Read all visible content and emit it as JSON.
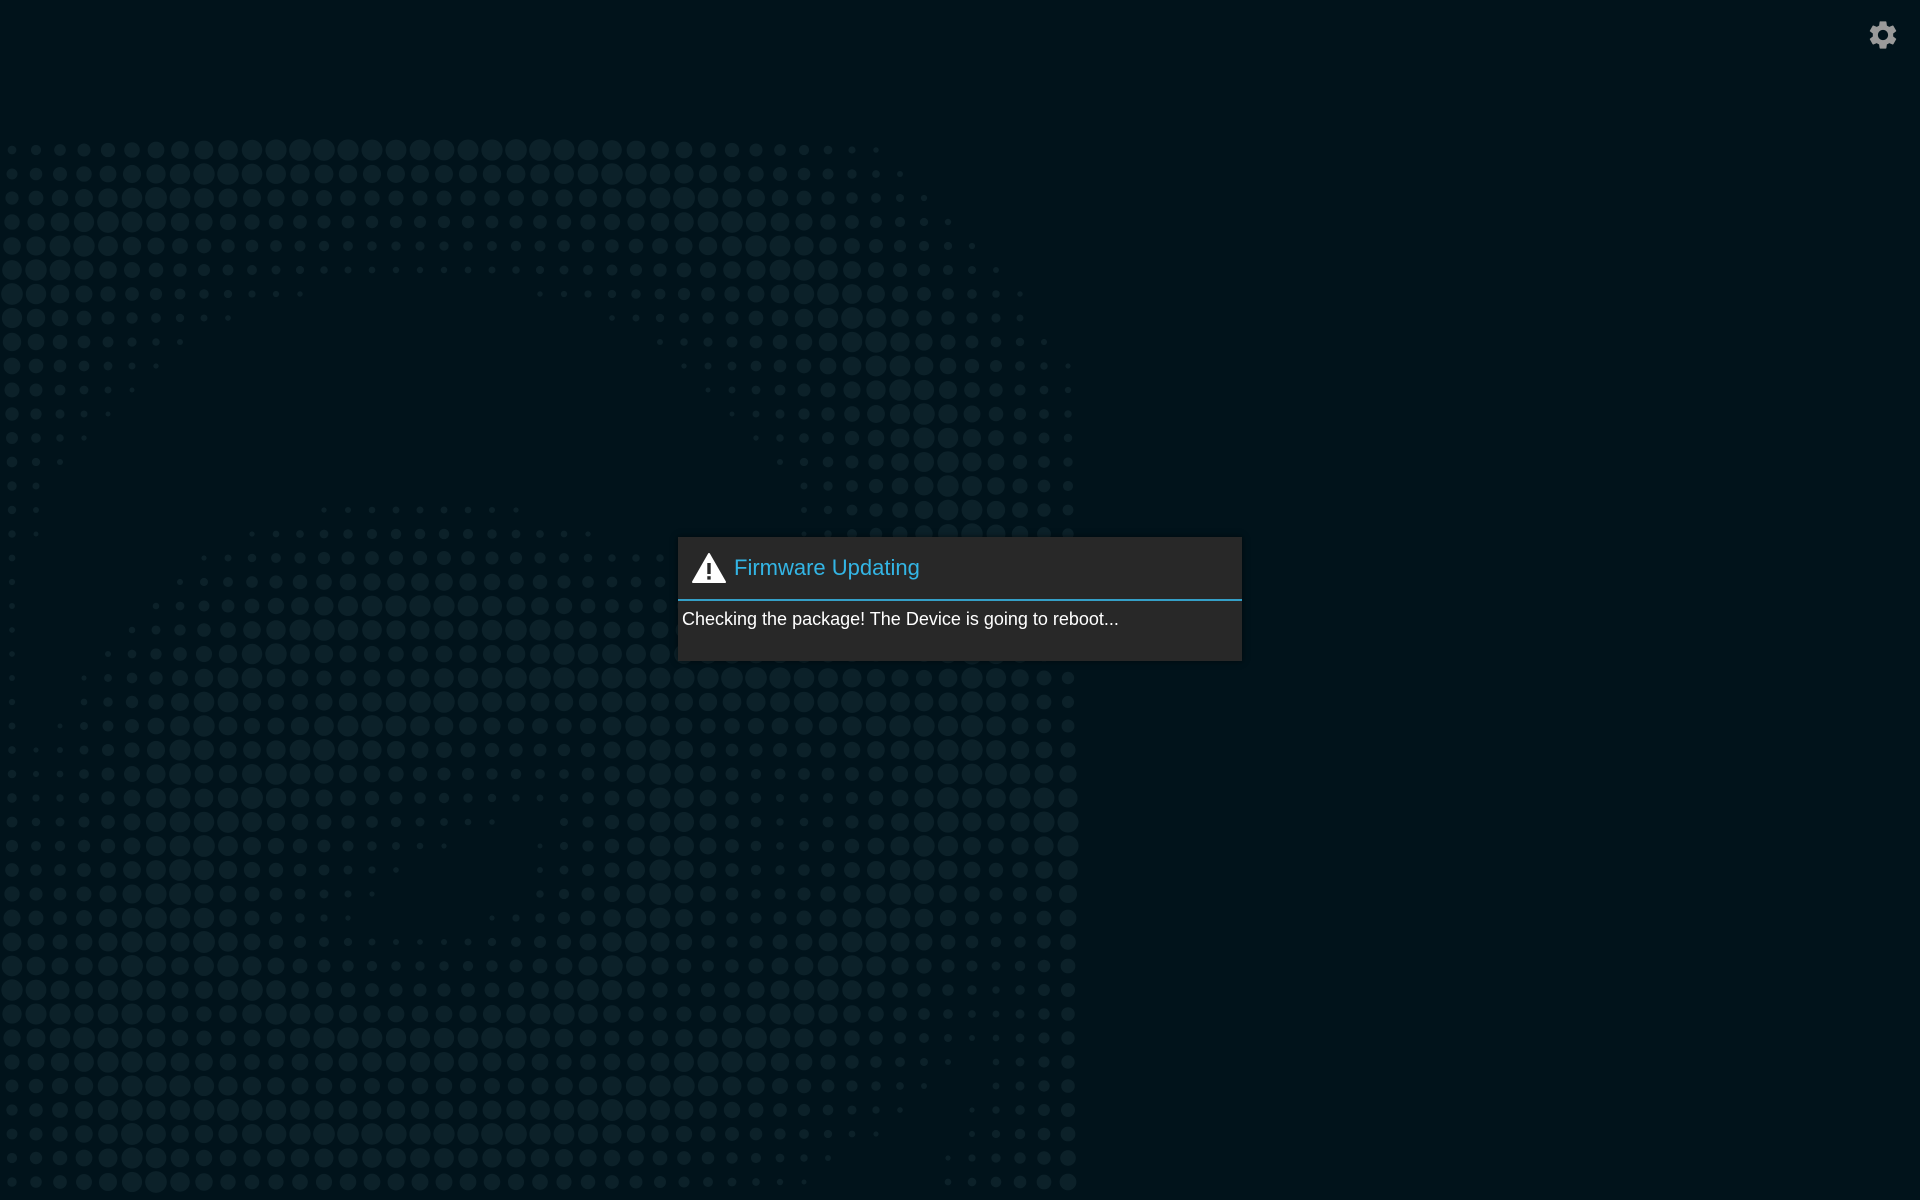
{
  "screen": {
    "background_color": "#01131b",
    "pattern_color": "#0c2129"
  },
  "settings": {
    "icon": "gear-icon",
    "color": "#9a9a9a"
  },
  "dialog": {
    "icon": "warning-icon",
    "title": "Firmware Updating",
    "title_color": "#33b5e5",
    "message": "Checking the package! The Device is going to reboot...",
    "background_color": "#282828",
    "divider_color": "#35a0c8"
  }
}
